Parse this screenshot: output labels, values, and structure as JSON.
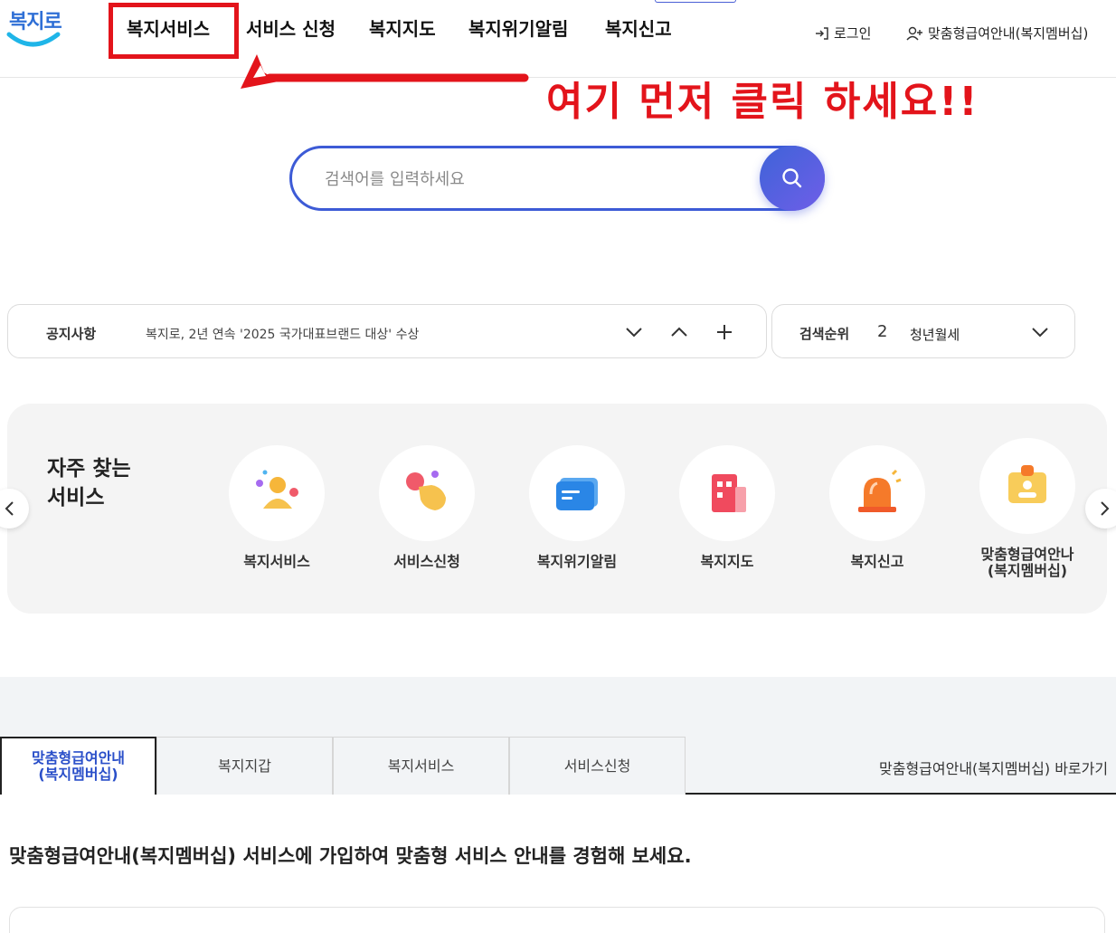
{
  "header": {
    "logo": "복지로",
    "nav": [
      "복지서비스",
      "서비스 신청",
      "복지지도",
      "복지위기알림",
      "복지신고"
    ],
    "login": "로그인",
    "membership": "맞춤형급여안내(복지멤버십)"
  },
  "annotation": {
    "text": "여기 먼저 클릭 하세요!!",
    "color": "#e3141b"
  },
  "search": {
    "placeholder": "검색어를 입력하세요"
  },
  "notice": {
    "label": "공지사항",
    "text": "복지로, 2년 연속 '2025 국가대표브랜드 대상' 수상"
  },
  "rank": {
    "label": "검색순위",
    "number": "2",
    "term": "청년월세"
  },
  "frequent": {
    "title": "자주 찾는\n서비스",
    "items": [
      {
        "label": "복지서비스",
        "icon": "people-icon"
      },
      {
        "label": "서비스신청",
        "icon": "hand-click-icon"
      },
      {
        "label": "복지위기알림",
        "icon": "message-icon"
      },
      {
        "label": "복지지도",
        "icon": "building-icon"
      },
      {
        "label": "복지신고",
        "icon": "siren-icon"
      },
      {
        "label": "맞춤형급여안나\n(복지멤버십)",
        "icon": "id-card-icon"
      }
    ]
  },
  "tabs": {
    "items": [
      "맞춤형급여안내\n(복지멤버십)",
      "복지지갑",
      "복지서비스",
      "서비스신청"
    ],
    "shortcut": "맞춤형급여안내(복지멤버십) 바로가기"
  },
  "content": {
    "headline": "맞춤형급여안내(복지멤버십) 서비스에 가입하여 맞춤형 서비스 안내를 경험해 보세요."
  },
  "colors": {
    "accent": "#3d5bd6",
    "highlight": "#e3141b"
  }
}
